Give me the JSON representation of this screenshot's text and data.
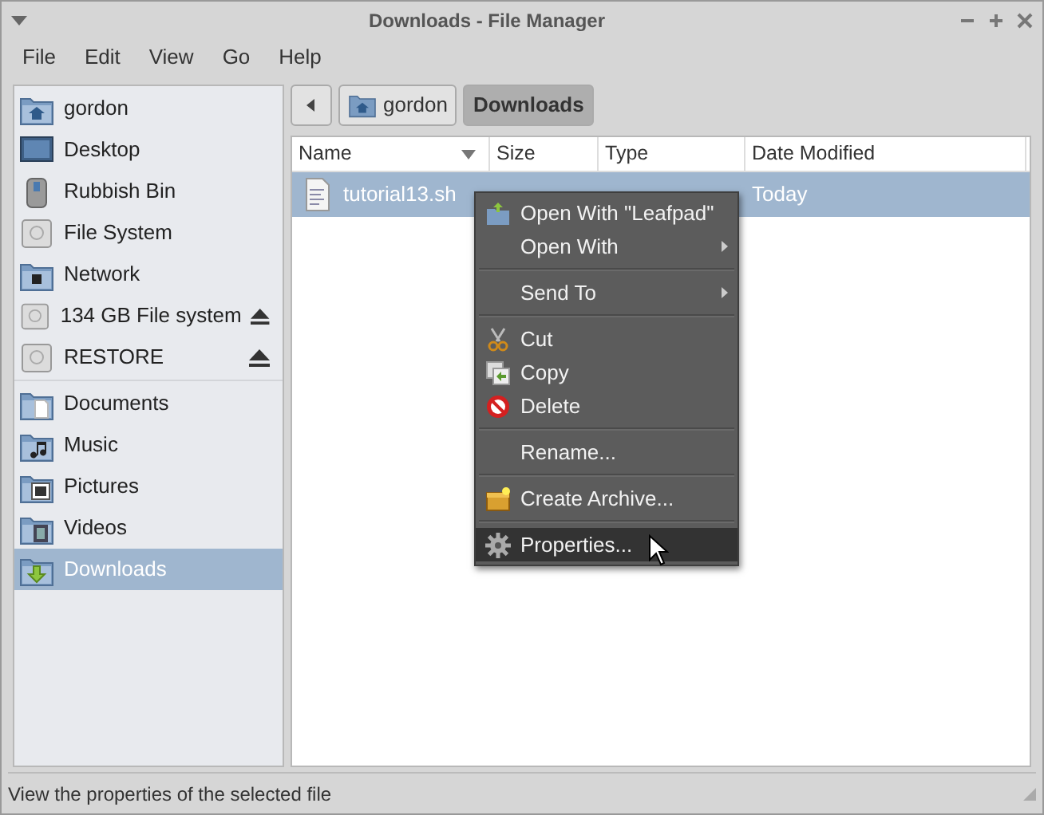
{
  "window": {
    "title": "Downloads - File Manager"
  },
  "menubar": [
    "File",
    "Edit",
    "View",
    "Go",
    "Help"
  ],
  "sidebar": {
    "groups": [
      [
        {
          "label": "gordon",
          "selected": false
        },
        {
          "label": "Desktop",
          "selected": false
        },
        {
          "label": "Rubbish Bin",
          "selected": false
        },
        {
          "label": "File System",
          "selected": false
        },
        {
          "label": "Network",
          "selected": false
        },
        {
          "label": "134 GB File system",
          "selected": false,
          "ejectable": true
        },
        {
          "label": "RESTORE",
          "selected": false,
          "ejectable": true
        }
      ],
      [
        {
          "label": "Documents",
          "selected": false
        },
        {
          "label": "Music",
          "selected": false
        },
        {
          "label": "Pictures",
          "selected": false
        },
        {
          "label": "Videos",
          "selected": false
        },
        {
          "label": "Downloads",
          "selected": true
        }
      ]
    ]
  },
  "pathbar": [
    {
      "label": "gordon",
      "selected": false
    },
    {
      "label": "Downloads",
      "selected": true
    }
  ],
  "table": {
    "columns": [
      {
        "label": "Name",
        "sorted": true
      },
      {
        "label": "Size",
        "sorted": false
      },
      {
        "label": "Type",
        "sorted": false
      },
      {
        "label": "Date Modified",
        "sorted": false
      }
    ],
    "rows": [
      {
        "name": "tutorial13.sh",
        "date": "Today",
        "selected": true
      }
    ]
  },
  "context_menu": [
    {
      "kind": "item",
      "label": "Open With \"Leafpad\""
    },
    {
      "kind": "submenu",
      "label": "Open With"
    },
    {
      "kind": "separator"
    },
    {
      "kind": "submenu",
      "label": "Send To"
    },
    {
      "kind": "separator"
    },
    {
      "kind": "item",
      "label": "Cut"
    },
    {
      "kind": "item",
      "label": "Copy"
    },
    {
      "kind": "item",
      "label": "Delete"
    },
    {
      "kind": "separator"
    },
    {
      "kind": "item",
      "label": "Rename..."
    },
    {
      "kind": "separator"
    },
    {
      "kind": "item",
      "label": "Create Archive..."
    },
    {
      "kind": "separator"
    },
    {
      "kind": "item",
      "label": "Properties...",
      "selected": true
    }
  ],
  "status_bar": "View the properties of the selected file"
}
